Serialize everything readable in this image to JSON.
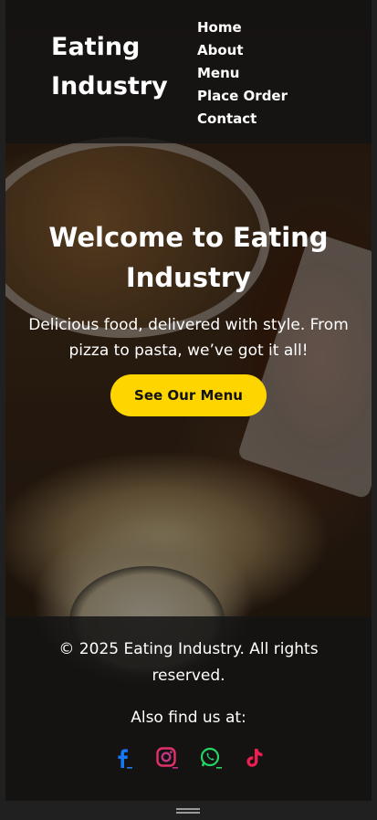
{
  "brand": {
    "name": "Eating Industry"
  },
  "nav": {
    "items": [
      {
        "label": "Home"
      },
      {
        "label": "About"
      },
      {
        "label": "Menu"
      },
      {
        "label": "Place Order"
      },
      {
        "label": "Contact"
      }
    ]
  },
  "hero": {
    "title": "Welcome to Eating Industry",
    "subtitle": "Delicious food, delivered with style. From pizza to pasta, we’ve got it all!",
    "cta_label": "See Our Menu"
  },
  "footer": {
    "copyright": "© 2025 Eating Industry. All rights reserved.",
    "find_us": "Also find us at:",
    "socials": [
      {
        "icon": "facebook-icon",
        "color": "#1877f2"
      },
      {
        "icon": "instagram-icon",
        "color": "#e1306c"
      },
      {
        "icon": "whatsapp-icon",
        "color": "#25d366"
      },
      {
        "icon": "tiktok-icon",
        "color": "#ee1d52"
      }
    ]
  },
  "colors": {
    "accent": "#ffd500",
    "header_bg": "#141414"
  }
}
